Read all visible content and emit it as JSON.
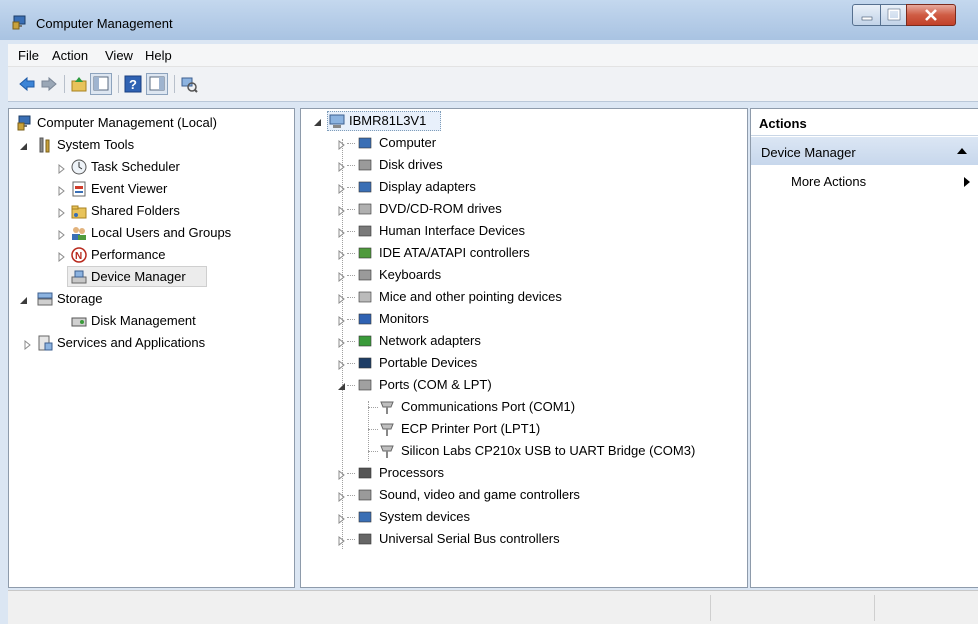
{
  "window": {
    "title": "Computer Management"
  },
  "menu": [
    "File",
    "Action",
    "View",
    "Help"
  ],
  "left_tree": {
    "root": "Computer Management (Local)",
    "system_tools": "System Tools",
    "task_scheduler": "Task Scheduler",
    "event_viewer": "Event Viewer",
    "shared_folders": "Shared Folders",
    "local_users": "Local Users and Groups",
    "performance": "Performance",
    "device_manager": "Device Manager",
    "storage": "Storage",
    "disk_management": "Disk Management",
    "services": "Services and Applications"
  },
  "device_tree": {
    "root": "IBMR81L3V1",
    "items": [
      "Computer",
      "Disk drives",
      "Display adapters",
      "DVD/CD-ROM drives",
      "Human Interface Devices",
      "IDE ATA/ATAPI controllers",
      "Keyboards",
      "Mice and other pointing devices",
      "Monitors",
      "Network adapters",
      "Portable Devices",
      "Ports (COM & LPT)",
      "Processors",
      "Sound, video and game controllers",
      "System devices",
      "Universal Serial Bus controllers"
    ],
    "ports_children": [
      "Communications Port (COM1)",
      "ECP Printer Port (LPT1)",
      "Silicon Labs CP210x USB to UART Bridge (COM3)"
    ]
  },
  "actions": {
    "header": "Actions",
    "section": "Device Manager",
    "more": "More Actions"
  }
}
